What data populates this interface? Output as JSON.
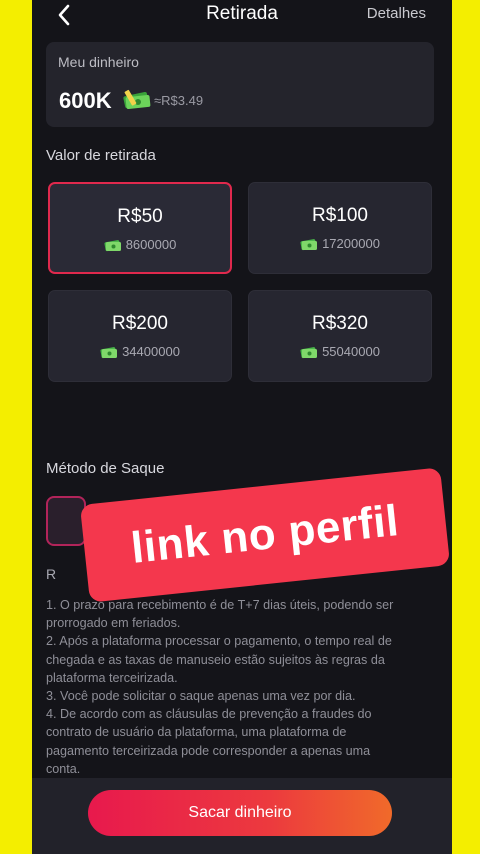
{
  "header": {
    "title": "Retirada",
    "details_label": "Detalhes"
  },
  "balance": {
    "label": "Meu dinheiro",
    "amount": "600K",
    "approx": "≈R$3.49"
  },
  "withdraw": {
    "label": "Valor de retirada",
    "options": [
      {
        "price": "R$50",
        "coins": "8600000",
        "selected": true
      },
      {
        "price": "R$100",
        "coins": "17200000",
        "selected": false
      },
      {
        "price": "R$200",
        "coins": "34400000",
        "selected": false
      },
      {
        "price": "R$320",
        "coins": "55040000",
        "selected": false
      }
    ]
  },
  "method": {
    "label": "Método de Saque"
  },
  "rules": {
    "heading_partial": "R",
    "lines": [
      "1. O prazo para recebimento é de T+7 dias úteis, podendo ser",
      "prorrogado em feriados.",
      "2. Após a plataforma processar o pagamento, o tempo real de",
      "chegada e as taxas de manuseio estão sujeitos às regras da",
      "plataforma terceirizada.",
      "3. Você pode solicitar o saque apenas uma vez por dia.",
      "4. De acordo com as cláusulas de prevenção a fraudes do",
      "contrato de usuário da plataforma, uma plataforma de",
      "pagamento terceirizada pode corresponder a apenas uma",
      "conta."
    ]
  },
  "overlay": {
    "text": "link no perfil"
  },
  "cta": {
    "label": "Sacar dinheiro"
  },
  "colors": {
    "accent": "#e8194d",
    "background": "#141419",
    "frame": "#f4ee00",
    "banner": "#f4374d"
  },
  "icons": {
    "back": "chevron-left-icon",
    "cash": "cash-stack-icon"
  }
}
